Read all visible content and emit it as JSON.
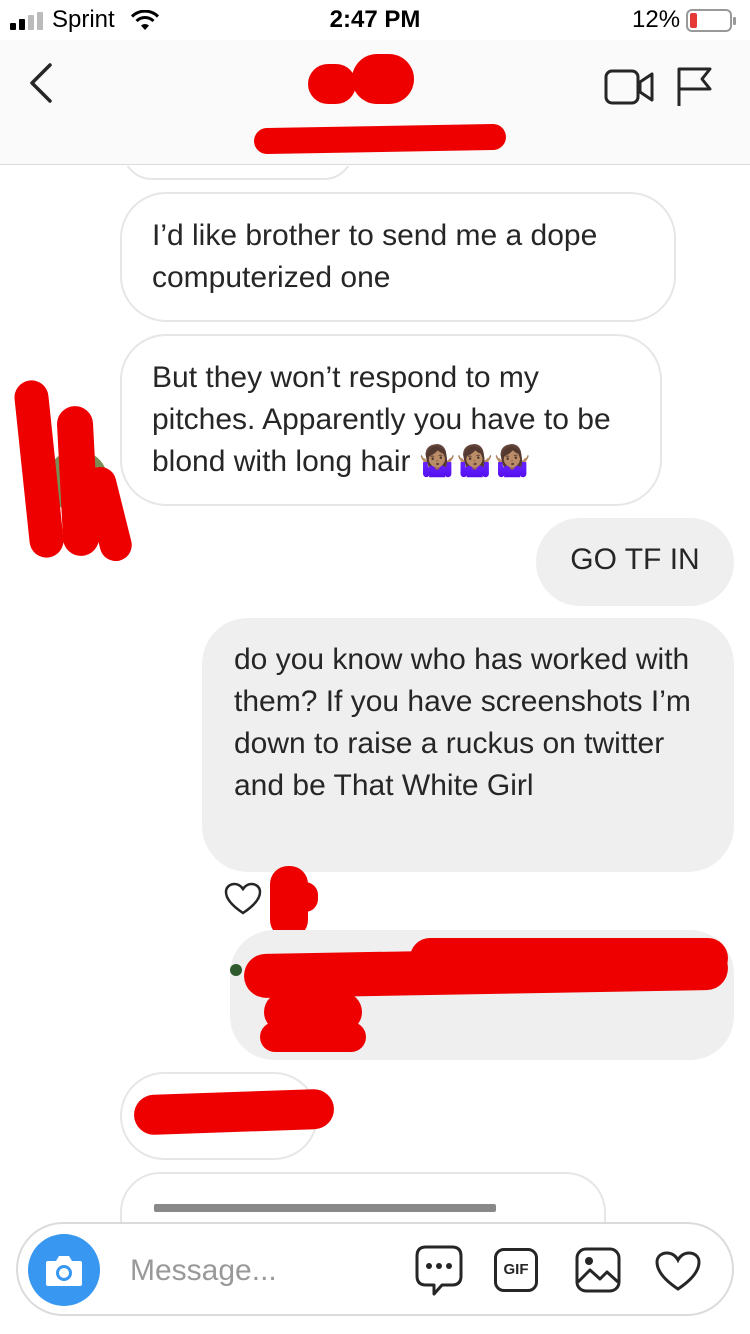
{
  "status_bar": {
    "carrier": "Sprint",
    "time": "2:47 PM",
    "battery": "12%"
  },
  "header": {
    "back_icon": "chevron-left-icon",
    "video_icon": "video-camera-icon",
    "flag_icon": "flag-icon"
  },
  "messages": [
    {
      "direction": "incoming",
      "text": "I’d like brother to send me a dope computerized one"
    },
    {
      "direction": "incoming",
      "text": "But they won’t respond to my pitches. Apparently you have to be blond with long hair 🤷🏽‍♀️🤷🏽‍♀️🤷🏽‍♀️"
    },
    {
      "direction": "outgoing",
      "text": "GO TF IN"
    },
    {
      "direction": "outgoing",
      "text": "do you know who has worked with them?  If you have screenshots I’m down to raise a ruckus on twitter and be That White Girl"
    }
  ],
  "composer": {
    "placeholder": "Message...",
    "gif_label": "GIF",
    "camera_icon": "camera-icon",
    "more_icon": "more-options-icon",
    "image_icon": "image-icon",
    "heart_icon": "heart-icon"
  },
  "colors": {
    "accent": "#3897f0",
    "incoming_bg": "#ffffff",
    "outgoing_bg": "#efefef",
    "redaction": "#ee0000"
  }
}
